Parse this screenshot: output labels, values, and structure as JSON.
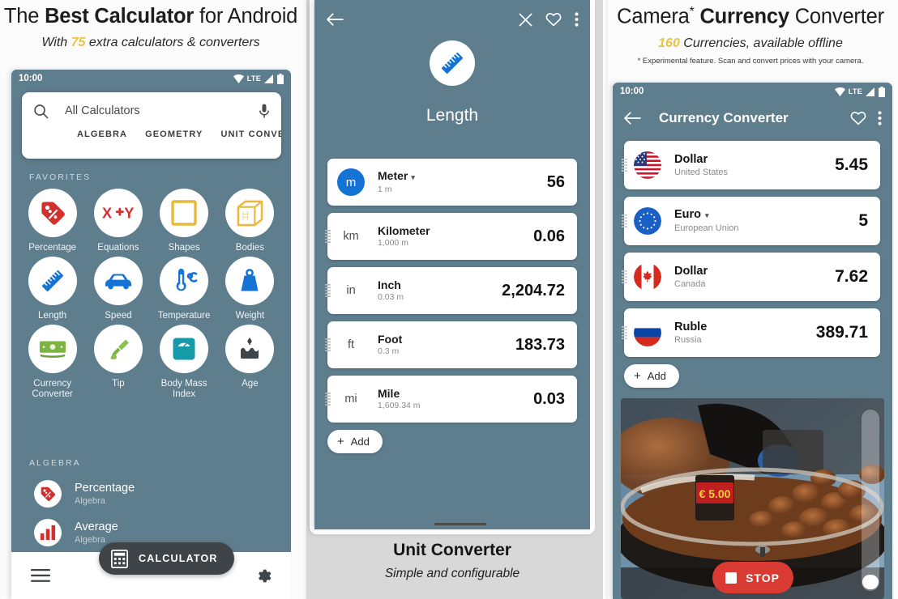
{
  "colors": {
    "phone_bg": "#5e7d8d",
    "accent_yellow": "#e8c34a",
    "blue": "#1673d6",
    "red": "#d32f2f",
    "green": "#7cb342",
    "teal": "#159aa8",
    "dark": "#3f4448",
    "stop_red": "#d93b33"
  },
  "left_panel": {
    "headline": {
      "pre": "The ",
      "bold": "Best Calculator",
      "post": " for Android"
    },
    "subhead": {
      "pre": "With ",
      "num": "75",
      "post": " extra calculators & converters"
    },
    "status_bar": {
      "time": "10:00",
      "network": "LTE",
      "icons": [
        "wifi-icon",
        "signal-icon",
        "battery-icon"
      ]
    },
    "search": {
      "icon": "search-icon",
      "value": "All Calculators",
      "placeholder": "All Calculators",
      "mic_icon": "microphone-icon"
    },
    "tabs": [
      "ALGEBRA",
      "GEOMETRY",
      "UNIT CONVERT"
    ],
    "favorites_label": "FAVORITES",
    "favorites": [
      {
        "label": "Percentage",
        "icon": "price-tag-icon",
        "color": "#d32f2f"
      },
      {
        "label": "Equations",
        "icon": "xy-equation-icon",
        "color": "#d32f2f"
      },
      {
        "label": "Shapes",
        "icon": "square-outline-icon",
        "color": "#e8b93a"
      },
      {
        "label": "Bodies",
        "icon": "cube-icon",
        "color": "#e8b93a"
      },
      {
        "label": "Length",
        "icon": "ruler-icon",
        "color": "#1673d6"
      },
      {
        "label": "Speed",
        "icon": "car-icon",
        "color": "#1673d6"
      },
      {
        "label": "Temperature",
        "icon": "thermometer-icon",
        "color": "#1673d6"
      },
      {
        "label": "Weight",
        "icon": "weight-icon",
        "color": "#1673d6"
      },
      {
        "label": "Currency\nConverter",
        "icon": "banknote-icon",
        "color": "#7cb342"
      },
      {
        "label": "Tip",
        "icon": "tip-hand-icon",
        "color": "#7cb342"
      },
      {
        "label": "Body Mass\nIndex",
        "icon": "bathroom-scale-icon",
        "color": "#159aa8"
      },
      {
        "label": "Age",
        "icon": "birthday-cake-icon",
        "color": "#4a4a4a"
      }
    ],
    "algebra_label": "ALGEBRA",
    "algebra_items": [
      {
        "title": "Percentage",
        "subtitle": "Algebra",
        "icon": "price-tag-icon"
      },
      {
        "title": "Average",
        "subtitle": "Algebra",
        "icon": "bar-chart-icon"
      }
    ],
    "fab": {
      "label": "CALCULATOR",
      "icon": "calculator-icon"
    },
    "bottom_bar": {
      "menu_icon": "hamburger-menu-icon",
      "settings_icon": "gear-icon"
    }
  },
  "mid_panel": {
    "appbar": {
      "back_icon": "back-arrow-icon",
      "close_icon": "close-icon",
      "favorite_icon": "heart-icon",
      "more_icon": "overflow-menu-icon"
    },
    "hero": {
      "icon": "ruler-icon",
      "title": "Length"
    },
    "units": [
      {
        "abbr": "m",
        "name": "Meter",
        "sub": "1 m",
        "value": "56",
        "selected": true,
        "dropdown": true
      },
      {
        "abbr": "km",
        "name": "Kilometer",
        "sub": "1,000 m",
        "value": "0.06",
        "selected": false,
        "dropdown": false
      },
      {
        "abbr": "in",
        "name": "Inch",
        "sub": "0.03 m",
        "value": "2,204.72",
        "selected": false,
        "dropdown": false
      },
      {
        "abbr": "ft",
        "name": "Foot",
        "sub": "0.3 m",
        "value": "183.73",
        "selected": false,
        "dropdown": false
      },
      {
        "abbr": "mi",
        "name": "Mile",
        "sub": "1,609.34 m",
        "value": "0.03",
        "selected": false,
        "dropdown": false
      }
    ],
    "add_button": {
      "label": "Add",
      "icon": "plus-icon"
    },
    "caption": {
      "title": "Unit Converter",
      "subtitle": "Simple and configurable"
    }
  },
  "right_panel": {
    "headline": {
      "pre": "Camera",
      "star": "*",
      "bold": " Currency",
      "post": " Converter"
    },
    "subhead": {
      "num": "160",
      "text": " Currencies, available offline"
    },
    "note": "* Experimental feature. Scan and convert prices with your camera.",
    "status_bar": {
      "time": "10:00",
      "network": "LTE"
    },
    "appbar": {
      "back_icon": "back-arrow-icon",
      "title": "Currency Converter",
      "favorite_icon": "heart-icon",
      "more_icon": "overflow-menu-icon"
    },
    "currencies": [
      {
        "name": "Dollar",
        "country": "United States",
        "value": "5.45",
        "flag": "flag-us",
        "dropdown": false
      },
      {
        "name": "Euro",
        "country": "European Union",
        "value": "5",
        "flag": "flag-eu",
        "dropdown": true
      },
      {
        "name": "Dollar",
        "country": "Canada",
        "value": "7.62",
        "flag": "flag-canada",
        "dropdown": false
      },
      {
        "name": "Ruble",
        "country": "Russia",
        "value": "389.71",
        "flag": "flag-russia",
        "dropdown": false
      }
    ],
    "add_button": {
      "label": "Add",
      "icon": "plus-icon"
    },
    "camera": {
      "price_tag": "€ 5.00",
      "stop_label": "STOP",
      "stop_icon": "stop-square-icon"
    }
  }
}
